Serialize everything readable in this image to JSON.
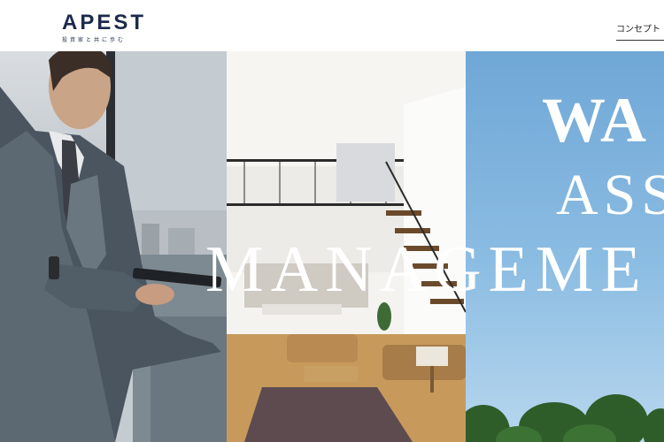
{
  "header": {
    "logo": "APEST",
    "tagline": "投資家と共に歩む",
    "nav": [
      "コンセプト"
    ]
  },
  "hero": {
    "headline_lines": [
      "WA",
      "ASS",
      "MANAGEME"
    ],
    "panels": [
      "businessman-photo",
      "interior-photo",
      "sky-trees-photo"
    ]
  },
  "colors": {
    "brand_navy": "#1d2a4c",
    "sky_blue": "#8cbde3",
    "headline_white": "#ffffff"
  }
}
